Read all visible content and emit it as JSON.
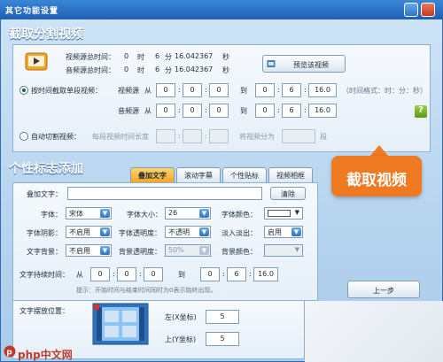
{
  "window": {
    "title": "其它功能设置"
  },
  "capture": {
    "title": "截取分割视频",
    "video_dur_label": "视频源总时间：",
    "audio_dur_label": "音频源总时间：",
    "video_dur": {
      "h": "0",
      "m": "6",
      "s": "16.042367"
    },
    "audio_dur": {
      "h": "0",
      "m": "6",
      "s": "16.042367"
    },
    "unit_h": "时",
    "unit_m": "分",
    "unit_s": "秒",
    "preview_button": "预览该视频",
    "mode_time_label": "按时间截取单段视频：",
    "video_src_label": "视频源",
    "audio_src_label": "音频源",
    "from_label": "从",
    "to_label": "到",
    "video_from": [
      "0",
      "0",
      "0"
    ],
    "video_to": [
      "0",
      "6",
      "16.0"
    ],
    "audio_from": [
      "0",
      "0",
      "0"
    ],
    "audio_to": [
      "0",
      "6",
      "16.0"
    ],
    "format_hint": "（时间格式：时：分：秒）",
    "help_glyph": "?",
    "mode_auto_label": "自动切割视频：",
    "segment_len_label": "每段视频时间长度",
    "split_label": "将视频分为",
    "seg_unit": "段",
    "colon": ":"
  },
  "callout": {
    "text": "截取视频"
  },
  "logo": {
    "title": "个性标志添加",
    "tabs": [
      "叠加文字",
      "滚动字幕",
      "个性贴标",
      "视频相框"
    ],
    "active_tab": 0,
    "overlay_text_label": "叠加文字：",
    "clear_button": "清除",
    "font_label": "字体：",
    "font_value": "宋体",
    "size_label": "字体大小：",
    "size_value": "26",
    "color_label": "字体颜色：",
    "shadow_label": "字体阴影：",
    "shadow_value": "不启用",
    "opacity_label": "字体透明度：",
    "opacity_value": "不透明",
    "fade_label": "淡入淡出：",
    "fade_value": "启用",
    "bg_label": "文字背景：",
    "bg_value": "不启用",
    "bg_opacity_label": "背景透明度：",
    "bg_opacity_value": "50%",
    "bg_color_label": "背景颜色：",
    "duration_label": "文字持续时间：",
    "from_label": "从",
    "to_label": "到",
    "dur_from": [
      "0",
      "0",
      "0"
    ],
    "dur_to": [
      "0",
      "6",
      "16.0"
    ],
    "hint": "提示：开始时间与结束时间同时为0表示始终出现。",
    "prev_button": "上一步",
    "pos_label": "文字摆放位置：",
    "left_label": "左(X坐标)",
    "left_value": "5",
    "top_label": "上(Y坐标)",
    "top_value": "5"
  },
  "watermark": {
    "text": "php中文网"
  }
}
